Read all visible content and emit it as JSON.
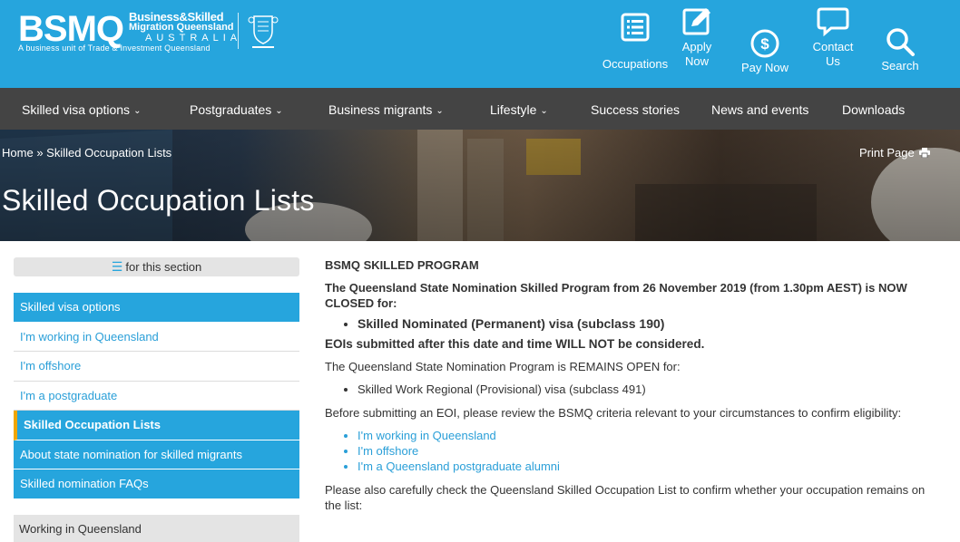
{
  "logo": {
    "brand": "BSMQ",
    "line1": "Business&Skilled",
    "line2": "Migration Queensland",
    "line3": "AUSTRALIA",
    "tagline": "A business unit of Trade & Investment Queensland"
  },
  "header_nav": [
    {
      "label1": "Occupations",
      "label2": "",
      "icon": "list-icon"
    },
    {
      "label1": "Apply",
      "label2": "Now",
      "icon": "edit-icon"
    },
    {
      "label1": "Pay Now",
      "label2": "",
      "icon": "dollar-icon"
    },
    {
      "label1": "Contact",
      "label2": "Us",
      "icon": "chat-icon"
    },
    {
      "label1": "Search",
      "label2": "",
      "icon": "search-icon"
    }
  ],
  "main_nav": [
    {
      "label": "Skilled visa options",
      "dropdown": true
    },
    {
      "label": "Postgraduates",
      "dropdown": true
    },
    {
      "label": "Business migrants",
      "dropdown": true
    },
    {
      "label": "Lifestyle",
      "dropdown": true
    },
    {
      "label": "Success stories",
      "dropdown": false
    },
    {
      "label": "News and events",
      "dropdown": false
    },
    {
      "label": "Downloads",
      "dropdown": false
    }
  ],
  "breadcrumb": {
    "home": "Home",
    "separator": "»",
    "current": "Skilled Occupation Lists"
  },
  "print_label": "Print Page",
  "page_title": "Skilled Occupation Lists",
  "sidebar": {
    "toggle_label": "for this section",
    "items": [
      {
        "label": "Skilled visa options"
      },
      {
        "label": "I'm working in Queensland"
      },
      {
        "label": "I'm offshore"
      },
      {
        "label": "I'm a postgraduate"
      },
      {
        "label": "Skilled Occupation Lists"
      },
      {
        "label": "About state nomination for skilled migrants"
      },
      {
        "label": "Skilled nomination FAQs"
      }
    ],
    "next_section": "Working in Queensland"
  },
  "content": {
    "heading": "BSMQ SKILLED PROGRAM",
    "closed_notice": "The Queensland State Nomination Skilled Program from 26 November 2019 (from 1.30pm AEST) is NOW CLOSED for:",
    "closed_items": [
      "Skilled Nominated (Permanent) visa (subclass 190)"
    ],
    "eoi_notice": "EOIs submitted after this date and time WILL NOT be considered.",
    "open_notice": "The Queensland State Nomination Program is REMAINS OPEN for:",
    "open_items": [
      "Skilled Work Regional (Provisional) visa (subclass 491)"
    ],
    "before_text": "Before submitting an EOI, please review the BSMQ criteria relevant to your circumstances to confirm eligibility:",
    "links": [
      "I'm working in Queensland",
      "I'm offshore",
      "I'm a Queensland postgraduate alumni"
    ],
    "check_text": "Please also carefully check the Queensland Skilled Occupation List to confirm whether your occupation remains on the list:"
  },
  "colors": {
    "brand_blue": "#26a5dd",
    "nav_dark": "#444444",
    "active_marker": "#f0a600",
    "link": "#2a9fd8"
  }
}
